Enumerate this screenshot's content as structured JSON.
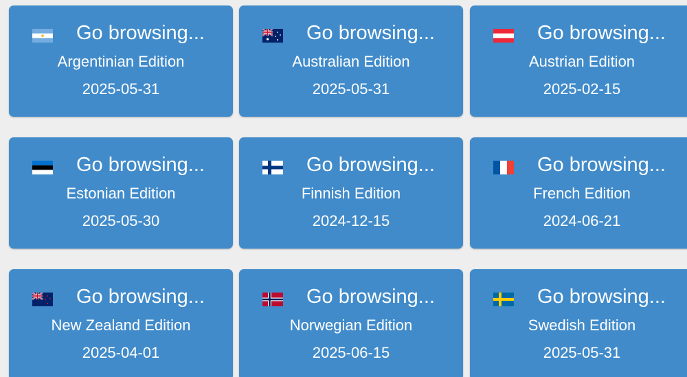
{
  "editions": [
    {
      "flag": "argentina-flag-icon",
      "link": "Go browsing...",
      "name": "Argentinian Edition",
      "date": "2025-05-31"
    },
    {
      "flag": "australia-flag-icon",
      "link": "Go browsing...",
      "name": "Australian Edition",
      "date": "2025-05-31"
    },
    {
      "flag": "austria-flag-icon",
      "link": "Go browsing...",
      "name": "Austrian Edition",
      "date": "2025-02-15"
    },
    {
      "flag": "estonia-flag-icon",
      "link": "Go browsing...",
      "name": "Estonian Edition",
      "date": "2025-05-30"
    },
    {
      "flag": "finland-flag-icon",
      "link": "Go browsing...",
      "name": "Finnish Edition",
      "date": "2024-12-15"
    },
    {
      "flag": "france-flag-icon",
      "link": "Go browsing...",
      "name": "French Edition",
      "date": "2024-06-21"
    },
    {
      "flag": "new-zealand-flag-icon",
      "link": "Go browsing...",
      "name": "New Zealand Edition",
      "date": "2025-04-01"
    },
    {
      "flag": "norway-flag-icon",
      "link": "Go browsing...",
      "name": "Norwegian Edition",
      "date": "2025-06-15"
    },
    {
      "flag": "sweden-flag-icon",
      "link": "Go browsing...",
      "name": "Swedish Edition",
      "date": "2025-05-31"
    }
  ],
  "colors": {
    "card_background": "#418bca",
    "page_background": "#eeeeee",
    "text": "#ffffff"
  }
}
